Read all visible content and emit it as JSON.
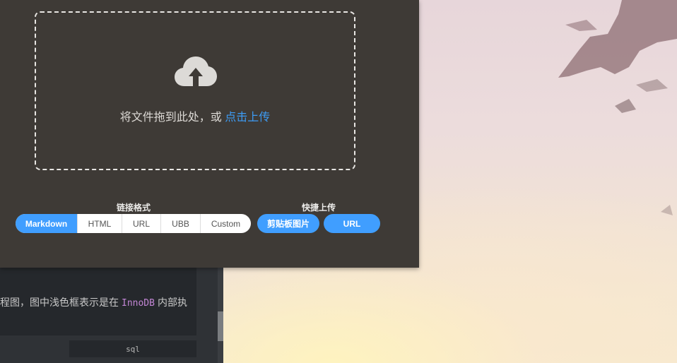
{
  "upload": {
    "drop_text": "将文件拖到此处，或",
    "drop_link": "点击上传",
    "icon": "cloud-upload-icon"
  },
  "link_format": {
    "label": "链接格式",
    "options": [
      "Markdown",
      "HTML",
      "URL",
      "UBB",
      "Custom"
    ],
    "selected": "Markdown"
  },
  "quick_upload": {
    "label": "快捷上传",
    "clipboard_label": "剪贴板图片",
    "url_label": "URL"
  },
  "editor": {
    "text_before": "程图，图中浅色框表示是在",
    "code": "InnoDB",
    "text_after": "内部执",
    "code_lang": "sql"
  },
  "colors": {
    "accent": "#409eff",
    "panel_bg": "#3e3a36",
    "link": "#3d9cf5"
  }
}
